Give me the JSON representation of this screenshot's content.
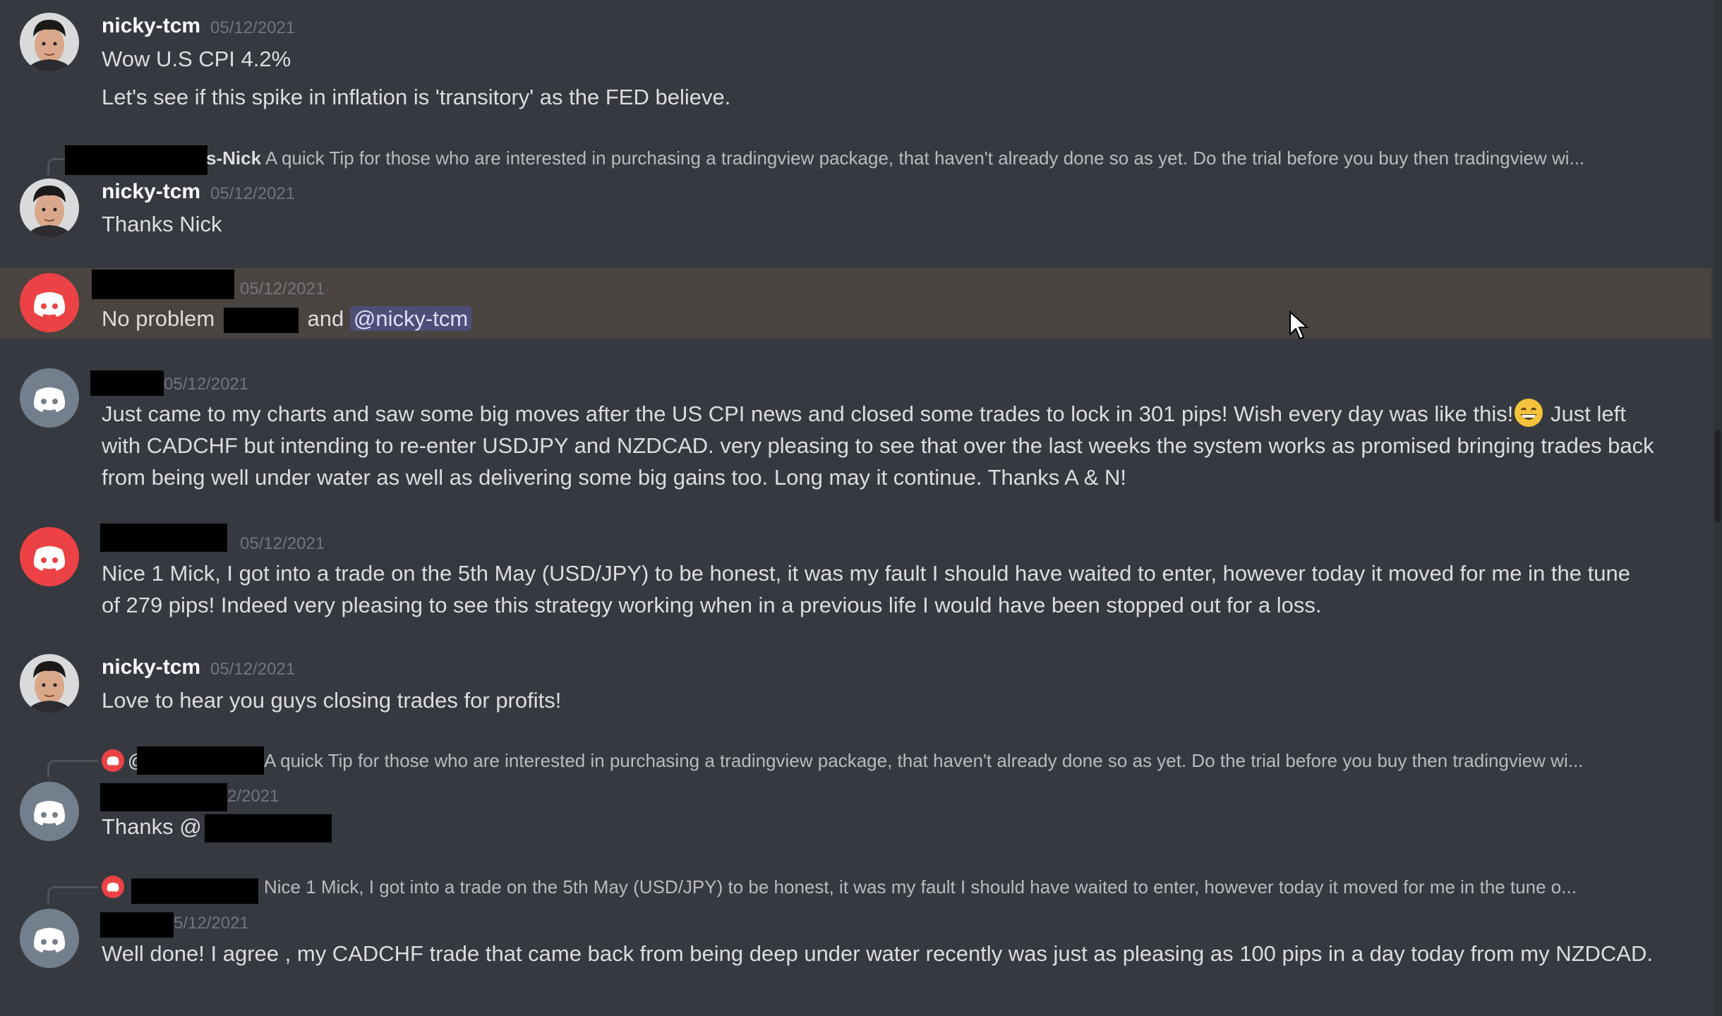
{
  "colors": {
    "background": "#36393f",
    "highlight": "#4a4440",
    "discord_red": "#ed4245",
    "discord_grey": "#747f8d",
    "mention_bg": "#4b4f8a"
  },
  "messages": [
    {
      "author": "nicky-tcm",
      "date": "05/12/2021",
      "avatar": "user-photo",
      "lines": [
        "Wow U.S CPI 4.2%",
        "Let's see if this spike in inflation is 'transitory' as the FED believe."
      ]
    },
    {
      "reply": {
        "name_suffix": "s-Nick",
        "text": "A quick Tip for those who are interested in purchasing a tradingview package, that haven't already done so as yet. Do the trial before you buy then tradingview wi..."
      },
      "author": "nicky-tcm",
      "date": "05/12/2021",
      "avatar": "user-photo",
      "text": "Thanks Nick"
    },
    {
      "date": "05/12/2021",
      "avatar": "discord-red",
      "text_pre": "No problem",
      "text_mid": "and",
      "mention": "@nicky-tcm"
    },
    {
      "date": "05/12/2021",
      "avatar": "discord-grey",
      "text_a": "Just came to my charts and saw some big moves after the US CPI news and closed some trades to lock in  301 pips! Wish every day was like this!",
      "emoji": "grinning-face-emoji",
      "text_b": " Just left with CADCHF but intending  to re-enter USDJPY and NZDCAD.  very pleasing to see that over the last weeks the system works as promised bringing trades back from being well under water as well as delivering some big gains too. Long may it continue. Thanks A & N!"
    },
    {
      "date": "05/12/2021",
      "avatar": "discord-red",
      "text": "Nice 1 Mick, I got into a trade on the 5th May (USD/JPY) to be honest, it was my fault I should have waited to enter, however today it moved for me in the tune of 279 pips! Indeed very pleasing to see this strategy working when in a previous life I would have been stopped out for a loss."
    },
    {
      "author": "nicky-tcm",
      "date": "05/12/2021",
      "avatar": "user-photo",
      "text": "Love to hear you guys closing trades for profits!"
    },
    {
      "reply": {
        "prefix": "@",
        "text": "A quick Tip for those who are interested in purchasing a tradingview package, that haven't already done so as yet. Do the trial before you buy then tradingview wi..."
      },
      "date": "2/2021",
      "avatar": "discord-grey",
      "text": "Thanks @"
    },
    {
      "reply": {
        "text": "Nice 1 Mick, I got into a trade on the 5th May (USD/JPY) to be honest, it was my fault I should have waited to enter, however today it moved for me in the tune o..."
      },
      "date": "5/12/2021",
      "avatar": "discord-grey",
      "text": "Well done! I agree , my CADCHF trade that came back from being deep under water recently was just as pleasing as 100 pips in a day today from my NZDCAD."
    }
  ]
}
